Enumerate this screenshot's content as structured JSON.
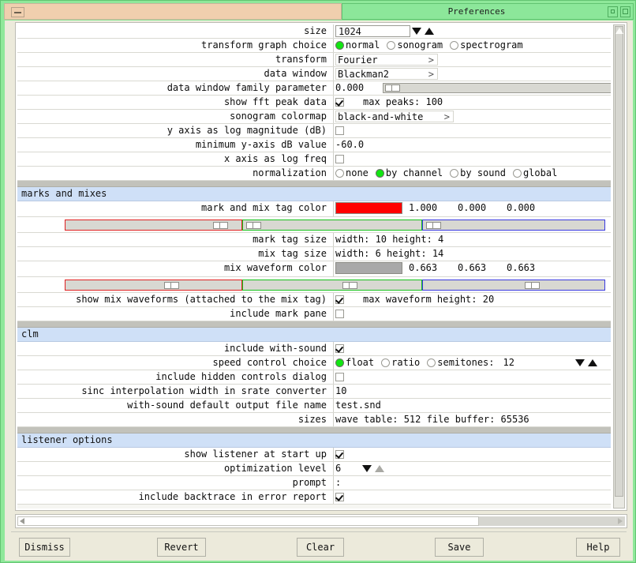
{
  "window": {
    "title": "Preferences",
    "minimize_icon": "minimize-icon",
    "restore_icon": "restore-icon",
    "close_icon": "close-icon"
  },
  "colors": {
    "title_left": "#f0cfae",
    "title_right": "#8ce79a",
    "section_header": "#cfe0f7",
    "mark_tag_swatch": "#ff0000",
    "mix_waveform_swatch": "#a9a9a9",
    "radio_on": "#12e512",
    "frame": "#8fe89a"
  },
  "sections": [
    {
      "id": "general",
      "title": "",
      "rows": [
        {
          "label": "size",
          "type": "spinner-text",
          "value": "1024",
          "down_icon": "triangle-down-icon",
          "up_icon": "triangle-up-icon"
        },
        {
          "label": "transform graph choice",
          "type": "radio",
          "options": [
            "normal",
            "sonogram",
            "spectrogram"
          ],
          "selected": "normal"
        },
        {
          "label": "transform",
          "type": "menu",
          "value": "Fourier",
          "arrow": ">"
        },
        {
          "label": "data window",
          "type": "menu",
          "value": "Blackman2",
          "arrow": ">"
        },
        {
          "label": "data window family parameter",
          "type": "slider-text",
          "value": "0.000",
          "slider_pct": 0
        },
        {
          "label": "show fft peak data",
          "type": "checkbox-text",
          "checked": true,
          "extra": "max peaks: 100"
        },
        {
          "label": "sonogram colormap",
          "type": "menu",
          "value": "black-and-white",
          "arrow": ">"
        },
        {
          "label": "y axis as log magnitude (dB)",
          "type": "checkbox",
          "checked": false
        },
        {
          "label": "minimum y-axis dB value",
          "type": "text",
          "value": "-60.0"
        },
        {
          "label": "x axis as log freq",
          "type": "checkbox",
          "checked": false
        },
        {
          "label": "normalization",
          "type": "radio",
          "options": [
            "none",
            "by channel",
            "by sound",
            "global"
          ],
          "selected": "by channel"
        }
      ]
    },
    {
      "id": "marks-and-mixes",
      "title": "marks and mixes",
      "rows": [
        {
          "label": "mark and mix tag color",
          "type": "color",
          "swatch": "#ff0000",
          "numbers": [
            "1.000",
            "0.000",
            "0.000"
          ],
          "rgb_pct": [
            93,
            2,
            2
          ]
        },
        {
          "label": "mark tag size",
          "type": "text",
          "value": "width: 10    height: 4"
        },
        {
          "label": "mix tag size",
          "type": "text",
          "value": "width: 6     height: 14"
        },
        {
          "label": "mix waveform color",
          "type": "color",
          "swatch": "#a9a9a9",
          "numbers": [
            "0.663",
            "0.663",
            "0.663"
          ],
          "rgb_pct": [
            62,
            62,
            62
          ]
        },
        {
          "label": "show mix waveforms (attached to the mix tag)",
          "type": "checkbox-text",
          "checked": true,
          "extra": "max waveform height: 20"
        },
        {
          "label": "include mark pane",
          "type": "checkbox",
          "checked": false
        }
      ]
    },
    {
      "id": "clm",
      "title": "clm",
      "rows": [
        {
          "label": "include with-sound",
          "type": "checkbox",
          "checked": true
        },
        {
          "label": "speed control choice",
          "type": "radio-spinner",
          "options": [
            "float",
            "ratio",
            "semitones:"
          ],
          "selected": "float",
          "spin_value": "12",
          "down_icon": "triangle-down-icon",
          "up_icon": "triangle-up-icon"
        },
        {
          "label": "include hidden controls dialog",
          "type": "checkbox",
          "checked": false
        },
        {
          "label": "sinc interpolation width in srate converter",
          "type": "text",
          "value": "10"
        },
        {
          "label": "with-sound default output file name",
          "type": "text",
          "value": "test.snd"
        },
        {
          "label": "sizes",
          "type": "text",
          "value": "wave table: 512      file buffer: 65536"
        }
      ]
    },
    {
      "id": "listener-options",
      "title": "listener options",
      "rows": [
        {
          "label": "show listener at start up",
          "type": "checkbox",
          "checked": true
        },
        {
          "label": "optimization level",
          "type": "spinner-value",
          "value": "6",
          "down_icon": "triangle-down-icon",
          "up_icon": "triangle-up-icon",
          "up_disabled": true
        },
        {
          "label": "prompt",
          "type": "text",
          "value": ":"
        },
        {
          "label": "include backtrace in error report",
          "type": "checkbox",
          "checked": true
        }
      ]
    }
  ],
  "buttons": [
    {
      "name": "dismiss",
      "label": "Dismiss"
    },
    {
      "name": "revert",
      "label": "Revert"
    },
    {
      "name": "clear",
      "label": "Clear"
    },
    {
      "name": "save",
      "label": "Save"
    },
    {
      "name": "help",
      "label": "Help"
    }
  ]
}
